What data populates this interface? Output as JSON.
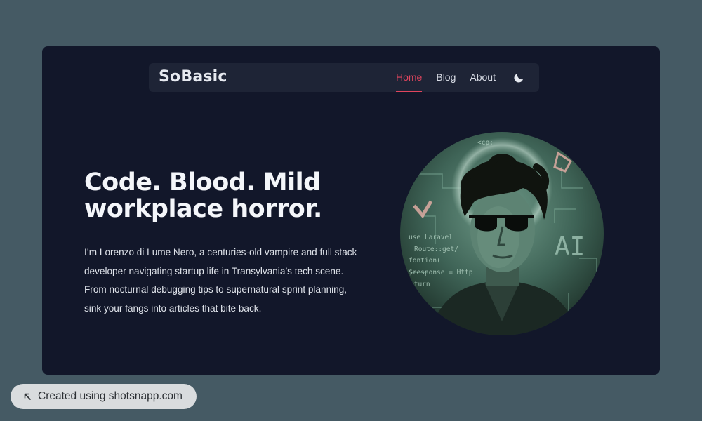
{
  "brand": {
    "name": "SoBasic"
  },
  "nav": {
    "items": [
      {
        "label": "Home",
        "active": true
      },
      {
        "label": "Blog",
        "active": false
      },
      {
        "label": "About",
        "active": false
      }
    ],
    "theme_toggle_icon": "moon-icon"
  },
  "hero": {
    "title": "Code. Blood. Mild workplace horror.",
    "description": "I’m Lorenzo di Lume Nero, a centuries-old vampire and full stack developer navigating startup life in Transylvania’s tech scene. From nocturnal debugging tips to supernatural sprint planning, sink your fangs into articles that bite back.",
    "portrait_code_lines": [
      "use Laravel",
      "Route::get/",
      "fontion(",
      "$response = Http",
      "eturn"
    ],
    "portrait_glyphs": [
      "AI",
      "<cp:"
    ]
  },
  "badge": {
    "label": "Created using shotsnapp.com",
    "icon": "arrow-up-left-icon"
  },
  "colors": {
    "page_background": "#455a64",
    "window_background": "#12172a",
    "navbar_background": "#1e2436",
    "accent": "#e0455e",
    "badge_background": "#d9dcde"
  }
}
